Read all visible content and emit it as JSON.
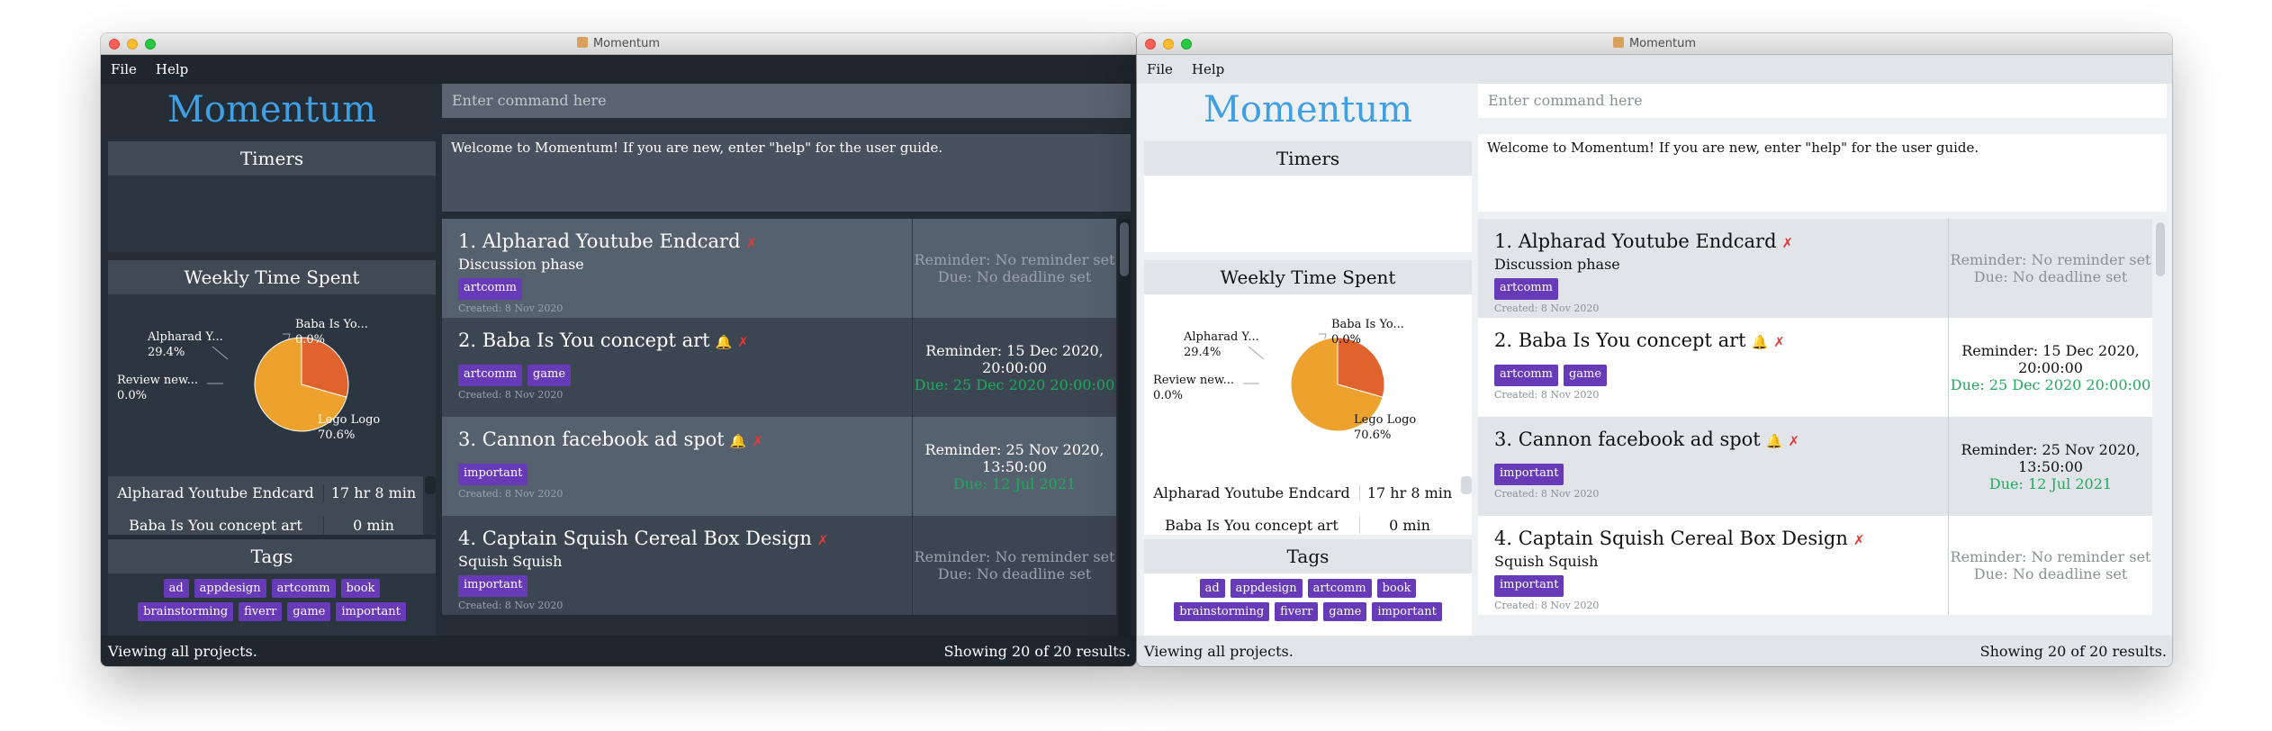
{
  "window": {
    "title": "Momentum"
  },
  "menu": [
    "File",
    "Help"
  ],
  "logo": "Momentum",
  "command": {
    "placeholder": "Enter command here"
  },
  "result_text": "Welcome to Momentum! If you are new, enter \"help\" for the user guide.",
  "timers": {
    "title": "Timers"
  },
  "weekly": {
    "title": "Weekly Time Spent",
    "labels": [
      {
        "name": "Alpharad Y...",
        "pct": "29.4%"
      },
      {
        "name": "Baba Is Yo...",
        "pct": "0.0%"
      },
      {
        "name": "Review new...",
        "pct": "0.0%"
      },
      {
        "name": "Lego Logo",
        "pct": "70.6%"
      }
    ],
    "table": [
      {
        "name": "Alpharad Youtube Endcard",
        "time": "17 hr 8 min"
      },
      {
        "name": "Baba Is You concept art",
        "time": "0 min"
      }
    ]
  },
  "chart_data": {
    "type": "pie",
    "title": "Weekly Time Spent",
    "slices": [
      {
        "label": "Alpharad Y...",
        "value": 29.4,
        "color": "#e0622c"
      },
      {
        "label": "Baba Is Yo...",
        "value": 0.0,
        "color": "#e8a030"
      },
      {
        "label": "Review new...",
        "value": 0.0,
        "color": "#e8a030"
      },
      {
        "label": "Lego Logo",
        "value": 70.6,
        "color": "#eea22e"
      }
    ]
  },
  "tags_panel": {
    "title": "Tags",
    "tags": [
      "ad",
      "appdesign",
      "artcomm",
      "book",
      "brainstorming",
      "fiverr",
      "game",
      "important"
    ]
  },
  "projects": [
    {
      "name": "1. Alpharad Youtube Endcard",
      "reminder_icon": false,
      "desc": "Discussion phase",
      "tags": [
        "artcomm"
      ],
      "created": "Created: 8 Nov 2020",
      "reminder": "Reminder: No reminder set",
      "due": "Due: No deadline set",
      "empty": true
    },
    {
      "name": "2. Baba Is You concept art",
      "reminder_icon": true,
      "desc": "",
      "tags": [
        "artcomm",
        "game"
      ],
      "created": "Created: 8 Nov 2020",
      "reminder": "Reminder: 15 Dec 2020, 20:00:00",
      "due": "Due: 25 Dec 2020 20:00:00",
      "empty": false
    },
    {
      "name": "3. Cannon facebook ad spot",
      "reminder_icon": true,
      "desc": "",
      "tags": [
        "important"
      ],
      "created": "Created: 8 Nov 2020",
      "reminder": "Reminder: 25 Nov 2020, 13:50:00",
      "due": "Due: 12 Jul 2021",
      "empty": false
    },
    {
      "name": "4. Captain Squish Cereal Box Design",
      "reminder_icon": false,
      "desc": "Squish Squish",
      "tags": [
        "important"
      ],
      "created": "Created: 8 Nov 2020",
      "reminder": "Reminder: No reminder set",
      "due": "Due: No deadline set",
      "empty": true
    }
  ],
  "status": {
    "left": "Viewing all projects.",
    "right": "Showing 20 of 20 results."
  },
  "colors": {
    "logo": "#3f9fe2",
    "tag": "#673ab7",
    "due_green": "#1faa5c",
    "delete_x": "#e53935",
    "dark_bg": "#242d36",
    "light_bg": "#eef1f4"
  }
}
